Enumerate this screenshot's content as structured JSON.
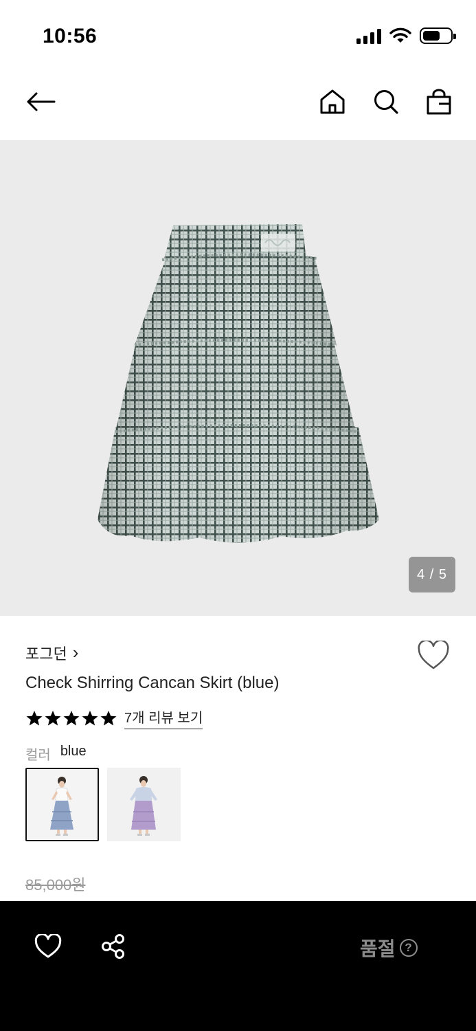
{
  "status_bar": {
    "time": "10:56",
    "icons": [
      "signal-icon",
      "wifi-icon",
      "battery-icon"
    ]
  },
  "nav": {
    "icons": [
      "back-arrow-icon",
      "home-icon",
      "search-icon",
      "shopping-bag-icon"
    ]
  },
  "gallery": {
    "counter": "4 / 5",
    "image": "plaid-tiered-skirt-photo"
  },
  "product": {
    "brand": "포그던",
    "brand_chevron": "›",
    "name": "Check Shirring Cancan Skirt (blue)",
    "rating_stars": 5,
    "review_link": "7개 리뷰 보기",
    "color_label": "컬러",
    "color_value": "blue",
    "swatches": [
      "model-wearing-blue-skirt-thumbnail",
      "model-wearing-lavender-skirt-thumbnail"
    ],
    "original_price": "85,000원"
  },
  "bottom_bar": {
    "sold_out_label": "품절",
    "help_glyph": "?",
    "icons": [
      "heart-outline-icon",
      "share-icon",
      "help-circle-icon"
    ]
  },
  "colors": {
    "accent": "#000000",
    "background": "#ffffff",
    "gallery_bg": "#ebebeb",
    "muted_text": "#9a9a9a",
    "soldout_text": "#8c8c8c"
  }
}
